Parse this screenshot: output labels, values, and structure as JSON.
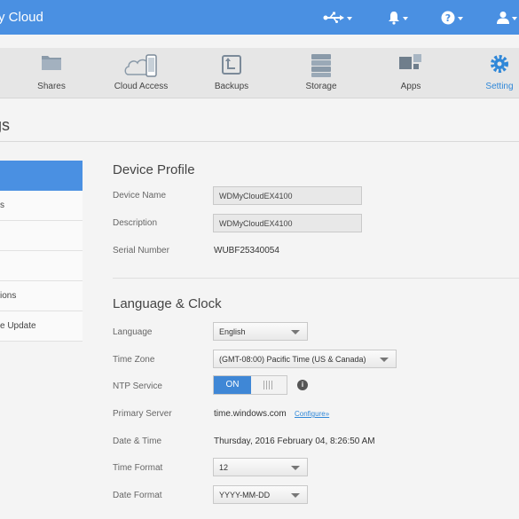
{
  "header": {
    "app_title": "y Cloud"
  },
  "nav": {
    "items": [
      {
        "label": "Shares"
      },
      {
        "label": "Cloud Access"
      },
      {
        "label": "Backups"
      },
      {
        "label": "Storage"
      },
      {
        "label": "Apps"
      },
      {
        "label": "Setting"
      }
    ],
    "active_color": "#2f87d8"
  },
  "page": {
    "heading": "gs"
  },
  "sidebar": {
    "items": [
      {
        "label": ""
      },
      {
        "label": "s"
      },
      {
        "label": ""
      },
      {
        "label": ""
      },
      {
        "label": "ions"
      },
      {
        "label": "e Update"
      }
    ]
  },
  "device_profile": {
    "title": "Device Profile",
    "device_name_label": "Device Name",
    "device_name_value": "WDMyCloudEX4100",
    "description_label": "Description",
    "description_value": "WDMyCloudEX4100",
    "serial_label": "Serial Number",
    "serial_value": "WUBF25340054"
  },
  "language_clock": {
    "title": "Language & Clock",
    "language_label": "Language",
    "language_value": "English",
    "timezone_label": "Time Zone",
    "timezone_value": "(GMT-08:00) Pacific Time (US & Canada)",
    "ntp_label": "NTP Service",
    "ntp_value": "ON",
    "primary_server_label": "Primary Server",
    "primary_server_value": "time.windows.com",
    "configure_link": "Configure»",
    "datetime_label": "Date & Time",
    "datetime_value": "Thursday, 2016 February 04, 8:26:50 AM",
    "time_format_label": "Time Format",
    "time_format_value": "12",
    "date_format_label": "Date Format",
    "date_format_value": "YYYY-MM-DD"
  }
}
